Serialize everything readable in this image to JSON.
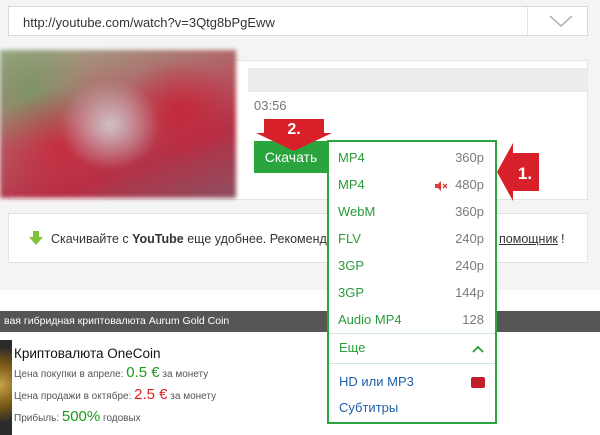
{
  "url_bar": {
    "value": "http://youtube.com/watch?v=3Qtg8bPgEww"
  },
  "video": {
    "duration": "03:56"
  },
  "download_button": {
    "label": "Скачать"
  },
  "promo": {
    "text_before": "Скачивайте с ",
    "brand": "YouTube",
    "text_after": " еще удобнее. Рекомендую",
    "link": "помощник",
    "end": "!"
  },
  "dropdown": {
    "formats": [
      {
        "format": "MP4",
        "quality": "360p"
      },
      {
        "format": "MP4",
        "quality": "480p",
        "muted": true
      },
      {
        "format": "WebM",
        "quality": "360p"
      },
      {
        "format": "FLV",
        "quality": "240p"
      },
      {
        "format": "3GP",
        "quality": "240p"
      },
      {
        "format": "3GP",
        "quality": "144p"
      },
      {
        "format": "Audio MP4",
        "quality": "128"
      }
    ],
    "more_label": "Еще",
    "links": [
      {
        "label": "HD или MP3"
      },
      {
        "label": "Субтитры"
      }
    ]
  },
  "annotations": {
    "step1": "1.",
    "step2": "2."
  },
  "ad": {
    "bar_text": "вая гибридная криптовалюта Aurum Gold Coin",
    "title": "Криптовалюта OneCoin",
    "buy_label": "Цена покупки в апреле: ",
    "buy_price": "0.5 €",
    "buy_suffix": " за монету",
    "sell_label": "Цена продажи в октябре: ",
    "sell_price": "2.5 €",
    "sell_suffix": " за монету",
    "profit_label": "Прибыль: ",
    "profit_value": "500%",
    "profit_suffix": " годовых"
  },
  "colors": {
    "accent_green": "#2aa43c",
    "annotation_red": "#d8202a",
    "link_blue": "#1f5fa8"
  }
}
